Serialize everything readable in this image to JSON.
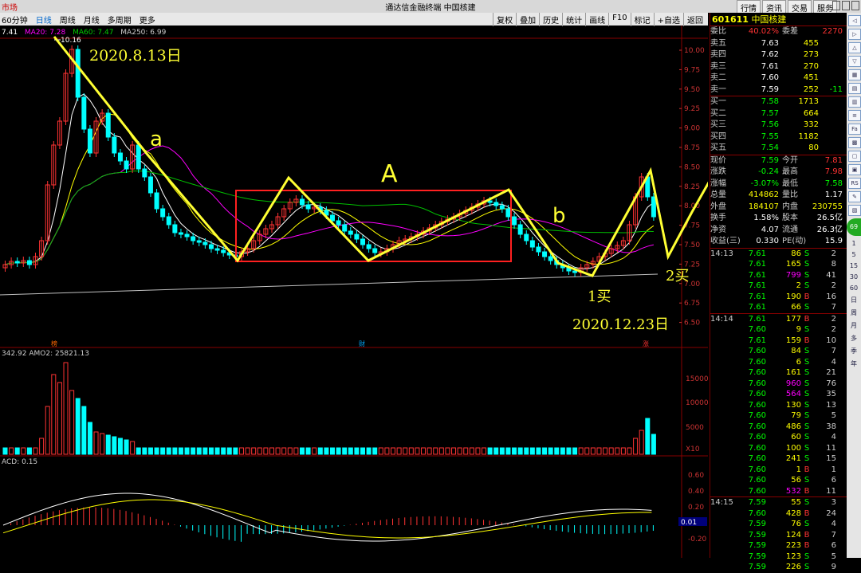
{
  "titlebar": {
    "left": "市场",
    "title": "通达信金融终端  中国核建",
    "buttons": [
      "行情",
      "资讯",
      "交易",
      "服务"
    ]
  },
  "toolbar": {
    "tabs": [
      "60分钟",
      "日线",
      "周线",
      "月线",
      "多周期",
      "更多"
    ],
    "active_tab": "日线",
    "right_tools": [
      "复权",
      "叠加",
      "历史",
      "统计",
      "画线",
      "F10",
      "标记",
      "+自选",
      "返回"
    ]
  },
  "indicators": {
    "ma_line": [
      "7.41",
      "MA20: 7.28",
      "MA60: 7.47",
      "MA250: 6.99"
    ],
    "vol_line": "342.92  AMO2: 25821.13",
    "macd_line": "ACD: 0.15",
    "macd_value": "0.01",
    "price_ticks": [
      "10.00",
      "9.75",
      "9.50",
      "9.25",
      "9.00",
      "8.75",
      "8.50",
      "8.25",
      "8.00",
      "7.75",
      "7.50",
      "7.25",
      "7.00",
      "6.75",
      "6.50"
    ],
    "vol_ticks": [
      "15000",
      "10000",
      "5000",
      "X10"
    ],
    "macd_ticks": [
      "0.60",
      "0.40",
      "0.20",
      "0.00",
      "-0.20"
    ],
    "high_label": "10.16",
    "markers": [
      "榜",
      "财",
      "涨"
    ]
  },
  "annotations": {
    "date1": "2020.8.13日",
    "a": "a",
    "A": "A",
    "b": "b",
    "buy1": "1买",
    "buy2": "2买",
    "date2": "2020.12.23日"
  },
  "quote": {
    "code": "601611",
    "name": "中国核建",
    "weibi": {
      "label": "委比",
      "value": "40.02%",
      "label2": "委差",
      "value2": "2270"
    },
    "asks": [
      {
        "label": "卖五",
        "price": "7.63",
        "vol": "455",
        "chg": ""
      },
      {
        "label": "卖四",
        "price": "7.62",
        "vol": "273",
        "chg": ""
      },
      {
        "label": "卖三",
        "price": "7.61",
        "vol": "270",
        "chg": ""
      },
      {
        "label": "卖二",
        "price": "7.60",
        "vol": "451",
        "chg": ""
      },
      {
        "label": "卖一",
        "price": "7.59",
        "vol": "252",
        "chg": "-11"
      }
    ],
    "bids": [
      {
        "label": "买一",
        "price": "7.58",
        "vol": "1713"
      },
      {
        "label": "买二",
        "price": "7.57",
        "vol": "664"
      },
      {
        "label": "买三",
        "price": "7.56",
        "vol": "332"
      },
      {
        "label": "买四",
        "price": "7.55",
        "vol": "1182"
      },
      {
        "label": "买五",
        "price": "7.54",
        "vol": "80"
      }
    ],
    "stats": [
      {
        "l1": "现价",
        "v1": "7.59",
        "l2": "今开",
        "v2": "7.81"
      },
      {
        "l1": "涨跌",
        "v1": "-0.24",
        "l2": "最高",
        "v2": "7.98"
      },
      {
        "l1": "涨幅",
        "v1": "-3.07%",
        "l2": "最低",
        "v2": "7.58"
      },
      {
        "l1": "总量",
        "v1": "414862",
        "l2": "量比",
        "v2": "1.17"
      },
      {
        "l1": "外盘",
        "v1": "184107",
        "l2": "内盘",
        "v2": "230755"
      },
      {
        "l1": "换手",
        "v1": "1.58%",
        "l2": "股本",
        "v2": "26.5亿"
      },
      {
        "l1": "净资",
        "v1": "4.07",
        "l2": "流通",
        "v2": "26.3亿"
      },
      {
        "l1": "收益(三)",
        "v1": "0.330",
        "l2": "PE(动)",
        "v2": "15.9"
      }
    ],
    "ticks": [
      {
        "t": "14:13",
        "p": "7.61",
        "v": "86",
        "bs": "S",
        "n": "2"
      },
      {
        "t": "",
        "p": "7.61",
        "v": "165",
        "bs": "S",
        "n": "8"
      },
      {
        "t": "",
        "p": "7.61",
        "v": "799",
        "bs": "S",
        "n": "41"
      },
      {
        "t": "",
        "p": "7.61",
        "v": "2",
        "bs": "S",
        "n": "2"
      },
      {
        "t": "",
        "p": "7.61",
        "v": "190",
        "bs": "B",
        "n": "16"
      },
      {
        "t": "",
        "p": "7.61",
        "v": "66",
        "bs": "S",
        "n": "7"
      },
      {
        "t": "14:14",
        "p": "7.61",
        "v": "177",
        "bs": "B",
        "n": "2"
      },
      {
        "t": "",
        "p": "7.60",
        "v": "9",
        "bs": "S",
        "n": "2"
      },
      {
        "t": "",
        "p": "7.61",
        "v": "159",
        "bs": "B",
        "n": "10"
      },
      {
        "t": "",
        "p": "7.60",
        "v": "84",
        "bs": "S",
        "n": "7"
      },
      {
        "t": "",
        "p": "7.60",
        "v": "6",
        "bs": "S",
        "n": "4"
      },
      {
        "t": "",
        "p": "7.60",
        "v": "161",
        "bs": "S",
        "n": "21"
      },
      {
        "t": "",
        "p": "7.60",
        "v": "960",
        "bs": "S",
        "n": "76"
      },
      {
        "t": "",
        "p": "7.60",
        "v": "564",
        "bs": "S",
        "n": "35"
      },
      {
        "t": "",
        "p": "7.60",
        "v": "130",
        "bs": "S",
        "n": "13"
      },
      {
        "t": "",
        "p": "7.60",
        "v": "79",
        "bs": "S",
        "n": "5"
      },
      {
        "t": "",
        "p": "7.60",
        "v": "486",
        "bs": "S",
        "n": "38"
      },
      {
        "t": "",
        "p": "7.60",
        "v": "60",
        "bs": "S",
        "n": "4"
      },
      {
        "t": "",
        "p": "7.60",
        "v": "100",
        "bs": "S",
        "n": "11"
      },
      {
        "t": "",
        "p": "7.60",
        "v": "241",
        "bs": "S",
        "n": "15"
      },
      {
        "t": "",
        "p": "7.60",
        "v": "1",
        "bs": "B",
        "n": "1"
      },
      {
        "t": "",
        "p": "7.60",
        "v": "56",
        "bs": "S",
        "n": "6"
      },
      {
        "t": "",
        "p": "7.60",
        "v": "532",
        "bs": "B",
        "n": "11"
      },
      {
        "t": "14:15",
        "p": "7.59",
        "v": "55",
        "bs": "S",
        "n": "3"
      },
      {
        "t": "",
        "p": "7.60",
        "v": "428",
        "bs": "B",
        "n": "24"
      },
      {
        "t": "",
        "p": "7.59",
        "v": "76",
        "bs": "S",
        "n": "4"
      },
      {
        "t": "",
        "p": "7.59",
        "v": "124",
        "bs": "B",
        "n": "7"
      },
      {
        "t": "",
        "p": "7.59",
        "v": "223",
        "bs": "B",
        "n": "6"
      },
      {
        "t": "",
        "p": "7.59",
        "v": "123",
        "bs": "S",
        "n": "5"
      },
      {
        "t": "",
        "p": "7.59",
        "v": "226",
        "bs": "S",
        "n": "9"
      }
    ],
    "time_header": "14:13"
  },
  "sidebar": {
    "items": [
      "1",
      "5",
      "15",
      "30",
      "60",
      "日",
      "周",
      "月",
      "多",
      "季",
      "年"
    ]
  },
  "colors": {
    "up": "#ff3333",
    "down": "#00ffff",
    "ma5": "#ffffff",
    "ma10": "#ffff00",
    "ma20": "#ff00ff",
    "ma60": "#00c000",
    "ma250": "#c0c0c0",
    "annot": "#ffff33",
    "box": "#ff2020"
  }
}
